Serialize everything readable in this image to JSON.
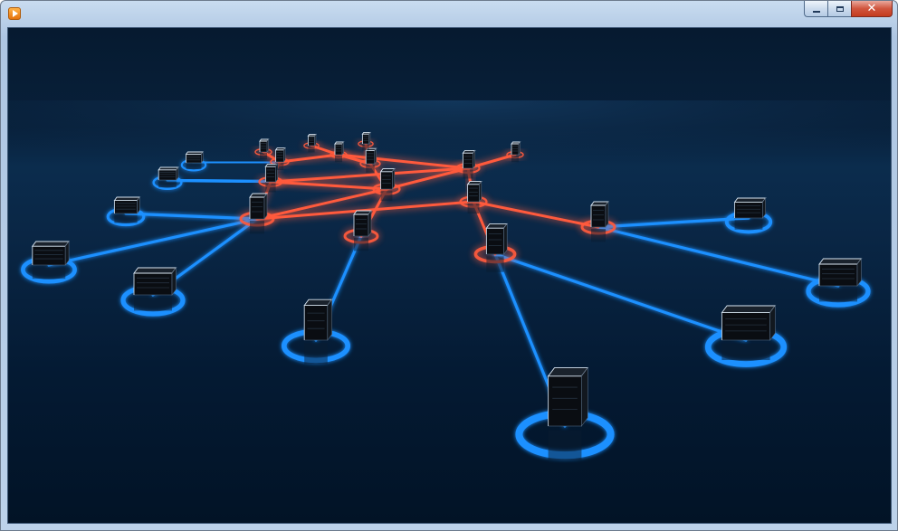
{
  "window": {
    "title": "",
    "controls": {
      "minimize": "minimize",
      "maximize": "maximize",
      "close": "✕"
    }
  },
  "scene": {
    "palette": {
      "background_top": "#061a30",
      "background_bottom": "#021326",
      "link_blue": "#1e90ff",
      "link_red": "#ff5a3c",
      "node_body": "#0a0d12",
      "node_edge": "#d9e6f2"
    },
    "node_icon": "server-tower-icon"
  }
}
